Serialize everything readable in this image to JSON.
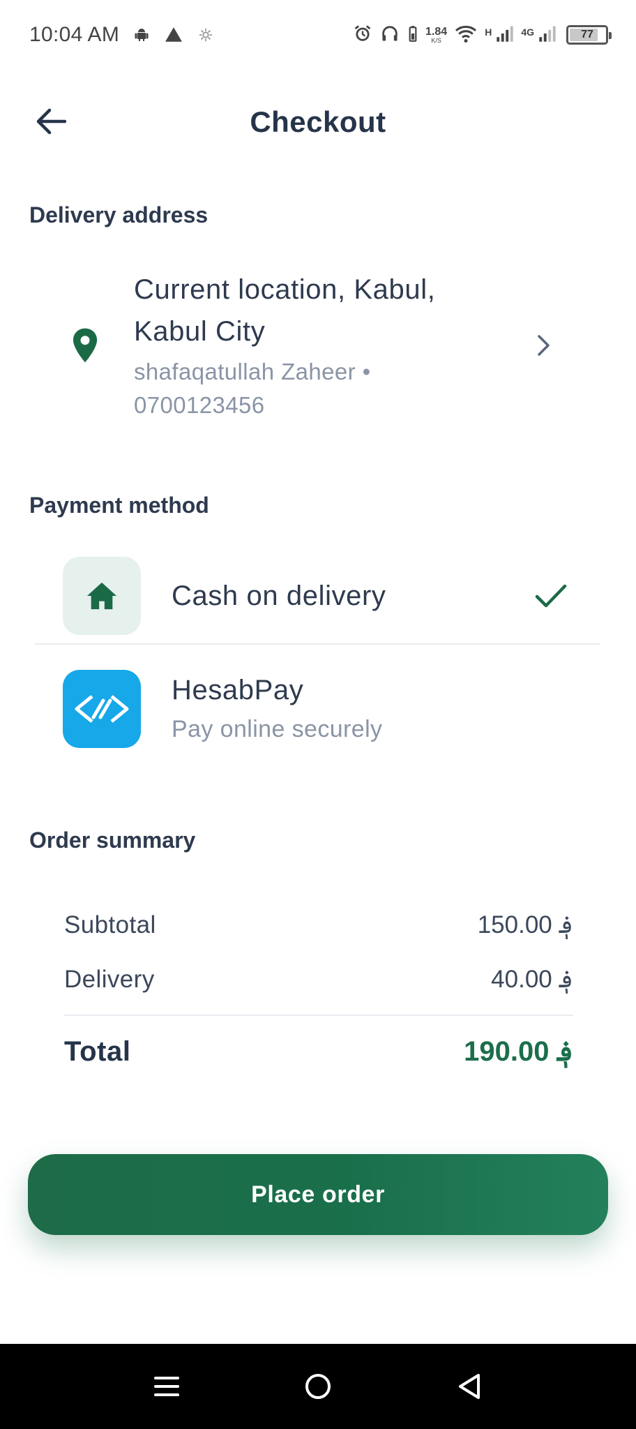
{
  "status_bar": {
    "time": "10:04 AM",
    "net_speed": "1.84",
    "net_speed_unit": "K/S",
    "signal1_label": "H",
    "signal2_label": "4G",
    "battery_level": "77"
  },
  "header": {
    "title": "Checkout"
  },
  "delivery": {
    "section_title": "Delivery address",
    "address_line": "Current location, Kabul, Kabul City",
    "contact_line": "shafaqatullah Zaheer • 0700123456"
  },
  "payment": {
    "section_title": "Payment method",
    "methods": [
      {
        "label": "Cash on delivery",
        "subtitle": "",
        "selected": true,
        "icon": "home-icon"
      },
      {
        "label": "HesabPay",
        "subtitle": "Pay online securely",
        "selected": false,
        "icon": "hesabpay-logo-icon"
      }
    ]
  },
  "summary": {
    "section_title": "Order summary",
    "subtotal_label": "Subtotal",
    "subtotal_value": "150.00 ؋",
    "delivery_label": "Delivery",
    "delivery_value": "40.00 ؋",
    "total_label": "Total",
    "total_value": "190.00 ؋"
  },
  "actions": {
    "place_order_label": "Place order"
  },
  "colors": {
    "accent": "#1c6e4b",
    "hesabpay": "#16a8e8",
    "text_primary": "#26344a",
    "text_secondary": "#8a94a6"
  }
}
